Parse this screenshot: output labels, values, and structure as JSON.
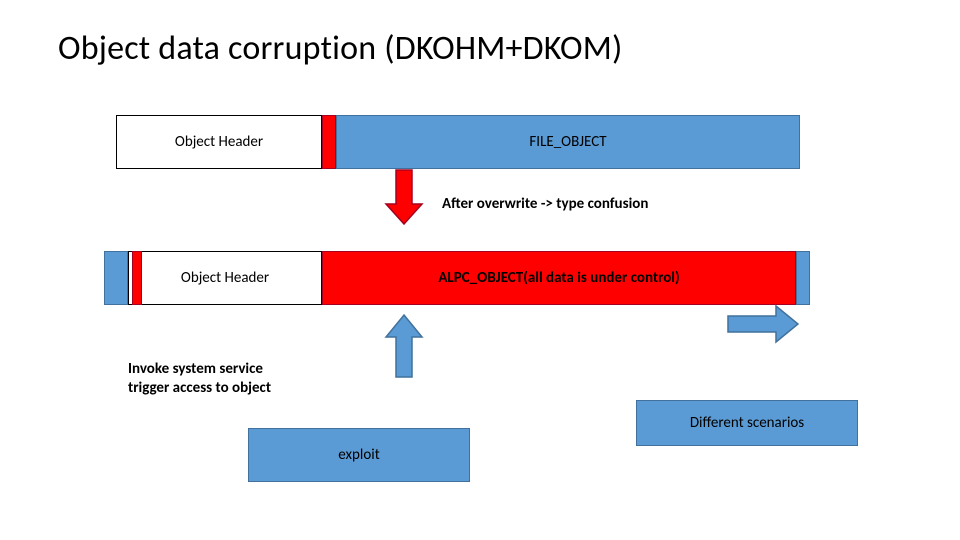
{
  "title": "Object data corruption (DKOHM+DKOM)",
  "row1": {
    "header": "Object Header",
    "body": "FILE_OBJECT"
  },
  "after_overwrite": "After overwrite -> type confusion",
  "row2": {
    "header": "Object Header",
    "body": "ALPC_OBJECT(all data is under control)"
  },
  "invoke_text_line1": "Invoke system service",
  "invoke_text_line2": "trigger access to object",
  "exploit": "exploit",
  "scenarios": "Different scenarios",
  "colors": {
    "blue": "#5b9bd5",
    "blue_border": "#41719c",
    "red": "#ff0000",
    "red_border": "#a50021"
  }
}
